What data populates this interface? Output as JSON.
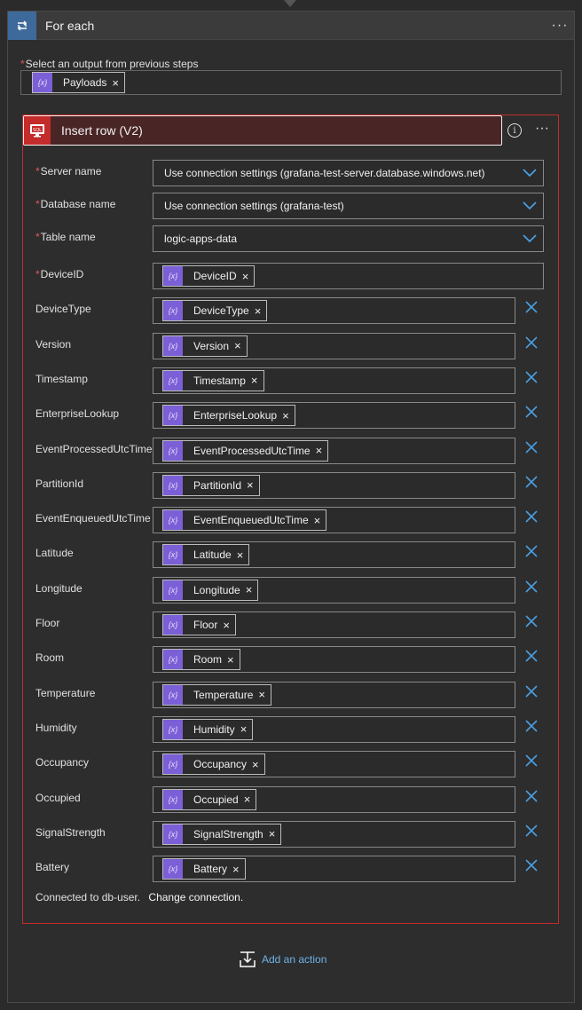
{
  "foreach": {
    "title": "For each",
    "more_label": "···",
    "select_output_label": "Select an output from previous steps",
    "select_output_token": "Payloads"
  },
  "insert": {
    "title": "Insert row (V2)",
    "more_label": "···",
    "info_label": "i",
    "dropdowns": [
      {
        "label": "Server name",
        "required": true,
        "value": "Use connection settings (grafana-test-server.database.windows.net)"
      },
      {
        "label": "Database name",
        "required": true,
        "value": "Use connection settings (grafana-test)"
      },
      {
        "label": "Table name",
        "required": true,
        "value": "logic-apps-data"
      }
    ],
    "fields": [
      {
        "label": "DeviceID",
        "required": true,
        "token": "DeviceID",
        "removable": false
      },
      {
        "label": "DeviceType",
        "required": false,
        "token": "DeviceType",
        "removable": true
      },
      {
        "label": "Version",
        "required": false,
        "token": "Version",
        "removable": true
      },
      {
        "label": "Timestamp",
        "required": false,
        "token": "Timestamp",
        "removable": true
      },
      {
        "label": "EnterpriseLookup",
        "required": false,
        "token": "EnterpriseLookup",
        "removable": true
      },
      {
        "label": "EventProcessedUtcTime",
        "required": false,
        "token": "EventProcessedUtcTime",
        "removable": true
      },
      {
        "label": "PartitionId",
        "required": false,
        "token": "PartitionId",
        "removable": true
      },
      {
        "label": "EventEnqueuedUtcTime",
        "required": false,
        "token": "EventEnqueuedUtcTime",
        "removable": true
      },
      {
        "label": "Latitude",
        "required": false,
        "token": "Latitude",
        "removable": true
      },
      {
        "label": "Longitude",
        "required": false,
        "token": "Longitude",
        "removable": true
      },
      {
        "label": "Floor",
        "required": false,
        "token": "Floor",
        "removable": true
      },
      {
        "label": "Room",
        "required": false,
        "token": "Room",
        "removable": true
      },
      {
        "label": "Temperature",
        "required": false,
        "token": "Temperature",
        "removable": true
      },
      {
        "label": "Humidity",
        "required": false,
        "token": "Humidity",
        "removable": true
      },
      {
        "label": "Occupancy",
        "required": false,
        "token": "Occupancy",
        "removable": true
      },
      {
        "label": "Occupied",
        "required": false,
        "token": "Occupied",
        "removable": true
      },
      {
        "label": "SignalStrength",
        "required": false,
        "token": "SignalStrength",
        "removable": true
      },
      {
        "label": "Battery",
        "required": false,
        "token": "Battery",
        "removable": true
      }
    ],
    "connected_text": "Connected to db-user.",
    "change_connection": "Change connection."
  },
  "add_action": {
    "label": "Add an action"
  },
  "colors": {
    "accent": "#3e6a9b",
    "sql_red": "#c42b2b",
    "token_purple": "#7b5fd6",
    "link_blue": "#6fb2e8",
    "remove_x_blue": "#4a9ee0"
  },
  "icons": {
    "foreach": "loop-icon",
    "sql": "sql-server-icon",
    "token": "dynamic-content-icon",
    "remove": "close-icon",
    "dropdown": "chevron-down-icon",
    "add_action": "add-action-icon"
  }
}
